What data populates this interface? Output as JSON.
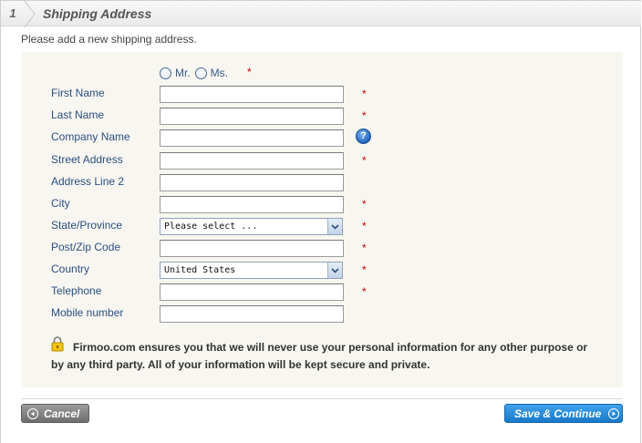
{
  "header": {
    "step_number": "1",
    "title": "Shipping Address"
  },
  "intro": "Please add a new shipping address.",
  "salutation": {
    "options": [
      "Mr.",
      "Ms."
    ],
    "required_mark": "*"
  },
  "fields": [
    {
      "label": "First Name",
      "required": "*"
    },
    {
      "label": "Last Name",
      "required": "*"
    },
    {
      "label": "Company Name",
      "required": ""
    },
    {
      "label": "Street Address",
      "required": "*"
    },
    {
      "label": "Address Line 2",
      "required": ""
    },
    {
      "label": "City",
      "required": "*"
    },
    {
      "label": "State/Province",
      "required": "*",
      "select_value": "Please select ..."
    },
    {
      "label": "Post/Zip Code",
      "required": "*"
    },
    {
      "label": "Country",
      "required": "*",
      "select_value": "United States"
    },
    {
      "label": "Telephone",
      "required": "*"
    },
    {
      "label": "Mobile number",
      "required": ""
    }
  ],
  "help_icon": "?",
  "security_notice": "Firmoo.com ensures you that we will never use your personal information for any other purpose or by any third party. All of your information will be kept secure and private.",
  "buttons": {
    "cancel": "Cancel",
    "save": "Save & Continue"
  },
  "colors": {
    "label": "#2c4f80",
    "required": "#cc0000",
    "save_button": "#1f86d6",
    "cancel_button": "#808080",
    "form_bg": "#f7f6f0"
  }
}
